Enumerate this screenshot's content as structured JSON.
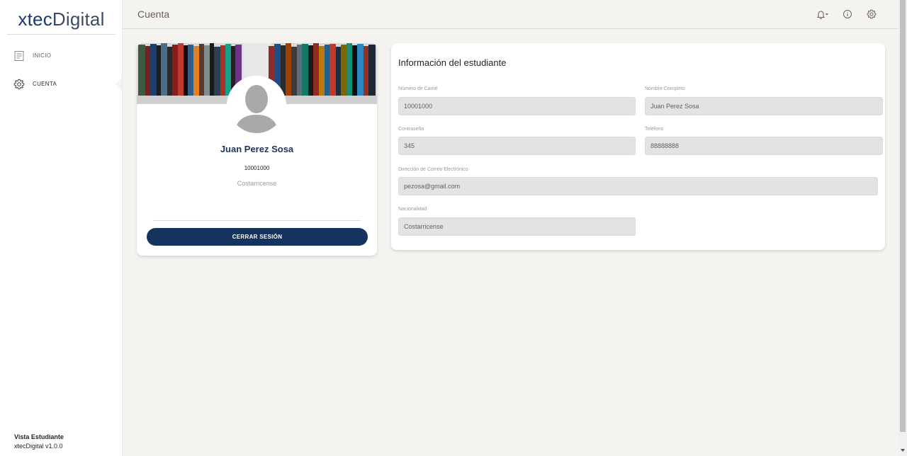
{
  "sidebar": {
    "logo_part1": "xtec",
    "logo_part2": "Digital",
    "items": [
      {
        "label": "INICIO",
        "icon": "document-icon"
      },
      {
        "label": "CUENTA",
        "icon": "gear-icon"
      }
    ],
    "footer_role": "Vista Estudiante",
    "footer_version": "xtecDigital v1.0.0"
  },
  "header": {
    "title": "Cuenta",
    "icons": [
      "bell-icon",
      "info-icon",
      "gear-icon"
    ]
  },
  "profile": {
    "name": "Juan Perez Sosa",
    "id": "10001000",
    "nationality": "Costarricense",
    "logout_label": "CERRAR SESIÓN"
  },
  "info": {
    "title": "Información del estudiante",
    "fields": {
      "carne": {
        "label": "Número de Carné",
        "value": "10001000"
      },
      "nombre": {
        "label": "Nombre Completo",
        "value": "Juan Perez Sosa"
      },
      "password": {
        "label": "Contraseña",
        "value": "345"
      },
      "telefono": {
        "label": "Teléfono",
        "value": "88888888"
      },
      "email": {
        "label": "Dirección de Correo Electrónico",
        "value": "pezosa@gmail.com"
      },
      "nacionalidad": {
        "label": "Nacionalidad",
        "value": "Costarricense"
      }
    }
  },
  "colors": {
    "primary": "#14345f",
    "background": "#f4f3ef",
    "input_bg": "#e3e3e3"
  }
}
